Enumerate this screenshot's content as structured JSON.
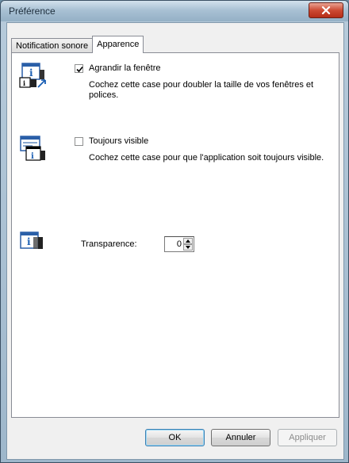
{
  "window": {
    "title": "Préférence"
  },
  "tabs": [
    {
      "label": "Notification sonore",
      "active": false
    },
    {
      "label": "Apparence",
      "active": true
    }
  ],
  "options": {
    "enlarge": {
      "label": "Agrandir la fenêtre",
      "checked": true,
      "description": "Cochez cette case pour doubler la taille de vos fenêtres et polices."
    },
    "always_visible": {
      "label": "Toujours visible",
      "checked": false,
      "description": "Cochez cette case pour que l'application soit toujours visible."
    },
    "transparency": {
      "label": "Transparence:",
      "value": "0"
    }
  },
  "buttons": {
    "ok": "OK",
    "cancel": "Annuler",
    "apply": "Appliquer"
  },
  "icons": {
    "close": "close-icon",
    "enlarge": "enlarge-window-icon",
    "always_visible": "window-on-top-icon",
    "transparency": "transparency-icon"
  },
  "colors": {
    "accent": "#1b5fb4",
    "close_button": "#cc4a33"
  }
}
